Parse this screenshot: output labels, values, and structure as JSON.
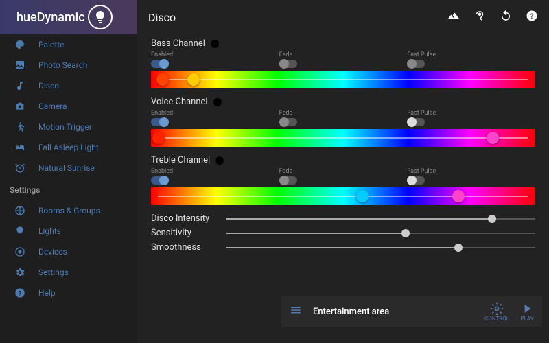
{
  "app": {
    "name": "hueDynamic"
  },
  "titlebar": {
    "title": "Disco"
  },
  "sidebar": {
    "items": [
      {
        "label": "Palette",
        "icon": "palette"
      },
      {
        "label": "Photo Search",
        "icon": "photo"
      },
      {
        "label": "Disco",
        "icon": "music"
      },
      {
        "label": "Camera",
        "icon": "camera"
      },
      {
        "label": "Motion Trigger",
        "icon": "walk"
      },
      {
        "label": "Fall Asleep Light",
        "icon": "bed"
      },
      {
        "label": "Natural Sunrise",
        "icon": "alarm"
      }
    ],
    "section_label": "Settings",
    "settings_items": [
      {
        "label": "Rooms & Groups",
        "icon": "globe"
      },
      {
        "label": "Lights",
        "icon": "bulb"
      },
      {
        "label": "Devices",
        "icon": "device"
      },
      {
        "label": "Settings",
        "icon": "gear"
      },
      {
        "label": "Help",
        "icon": "help"
      }
    ]
  },
  "channels": [
    {
      "title": "Bass Channel",
      "toggles": {
        "enabled": {
          "label": "Enabled",
          "on": true
        },
        "fade": {
          "label": "Fade",
          "on": false
        },
        "fastpulse": {
          "label": "Fast Pulse",
          "on": false
        }
      },
      "thumbs": [
        {
          "pos": 3,
          "color": "#ff4400"
        },
        {
          "pos": 11,
          "color": "#ffcc00"
        }
      ]
    },
    {
      "title": "Voice Channel",
      "toggles": {
        "enabled": {
          "label": "Enabled",
          "on": true
        },
        "fade": {
          "label": "Fade",
          "on": false
        },
        "fastpulse": {
          "label": "Fast Pulse",
          "on": false,
          "white": true
        }
      },
      "thumbs": [
        {
          "pos": 2,
          "color": "#ff2200"
        },
        {
          "pos": 89,
          "color": "#ff44cc"
        }
      ]
    },
    {
      "title": "Treble Channel",
      "toggles": {
        "enabled": {
          "label": "Enabled",
          "on": true
        },
        "fade": {
          "label": "Fade",
          "on": false
        },
        "fastpulse": {
          "label": "Fast Pulse",
          "on": false,
          "white": true
        }
      },
      "thumbs": [
        {
          "pos": 55,
          "color": "#00ccff"
        },
        {
          "pos": 80,
          "color": "#ff44cc"
        }
      ]
    }
  ],
  "sliders": [
    {
      "label": "Disco Intensity",
      "value": 86
    },
    {
      "label": "Sensitivity",
      "value": 58
    },
    {
      "label": "Smoothness",
      "value": 75
    }
  ],
  "bottom": {
    "area": "Entertainment area",
    "control": "CONTROL",
    "play": "PLAY"
  }
}
